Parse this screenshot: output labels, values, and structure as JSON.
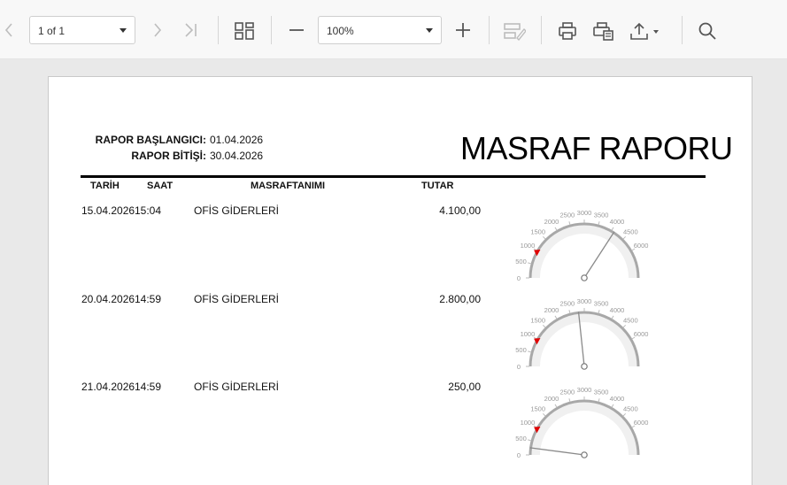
{
  "toolbar": {
    "page_indicator": "1 of 1",
    "zoom": "100%",
    "icons": [
      "chevron-left-icon",
      "chevron-right-icon",
      "last-page-icon",
      "thumbnails-icon",
      "zoom-out-icon",
      "zoom-in-icon",
      "edit-fields-icon",
      "print-icon",
      "print-page-icon",
      "export-icon",
      "search-icon"
    ]
  },
  "report": {
    "start_label": "RAPOR BAŞLANGICI:",
    "start_value": "01.04.2026",
    "end_label": "RAPOR BİTİŞİ:",
    "end_value": "30.04.2026",
    "title": "MASRAF RAPORU",
    "columns": {
      "date": "TARİH",
      "time": "SAAT",
      "desc": "MASRAFTANIMI",
      "amount": "TUTAR"
    },
    "rows": [
      {
        "date": "15.04.2026",
        "time": "15:04",
        "desc": "OFİS GİDERLERİ",
        "amount": "4.100,00",
        "gauge_value": 4100
      },
      {
        "date": "20.04.2026",
        "time": "14:59",
        "desc": "OFİS GİDERLERİ",
        "amount": "2.800,00",
        "gauge_value": 2800
      },
      {
        "date": "21.04.2026",
        "time": "14:59",
        "desc": "OFİS GİDERLERİ",
        "amount": "250,00",
        "gauge_value": 250
      }
    ],
    "gauge": {
      "min": 0,
      "max": 6000,
      "ticks": [
        "0",
        "500",
        "1000",
        "1500",
        "2000",
        "2500",
        "3000",
        "3500",
        "4000",
        "4500",
        "6000"
      ],
      "marker_value": 1000,
      "marker_color": "#e00000",
      "arc_color": "#a8a8a8",
      "band_color": "#f0f0f0"
    }
  }
}
